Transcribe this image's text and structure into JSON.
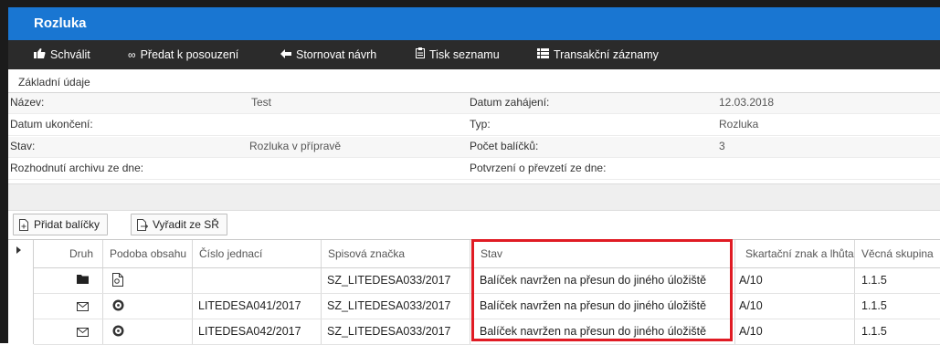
{
  "title": "Rozluka",
  "toolbar": {
    "approve": "Schválit",
    "review": "Předat k posouzení",
    "cancel": "Stornovat návrh",
    "print": "Tisk seznamu",
    "transactions": "Transakční záznamy"
  },
  "section": "Základní údaje",
  "form": {
    "nazev_label": "Název:",
    "nazev_value": "Test",
    "datum_zahajeni_label": "Datum zahájení:",
    "datum_zahajeni_value": "12.03.2018",
    "datum_ukonceni_label": "Datum ukončení:",
    "typ_label": "Typ:",
    "typ_value": "Rozluka",
    "stav_label": "Stav:",
    "stav_value": "Rozluka v přípravě",
    "pocet_label": "Počet balíčků:",
    "pocet_value": "3",
    "rozhodnuti_label": "Rozhodnutí archivu ze dne:",
    "potvrzeni_label": "Potvrzení o převzetí ze dne:"
  },
  "buttons": {
    "add": "Přidat balíčky",
    "remove": "Vyřadit ze SŘ"
  },
  "grid": {
    "headers": [
      "Druh",
      "Podoba obsahu",
      "Číslo jednací",
      "Spisová značka",
      "Stav",
      "Skartační znak a lhůta",
      "Věcná skupina"
    ],
    "rows": [
      {
        "druh_icon": "folder-icon",
        "podoba_icon": "document-icon",
        "cislo": "",
        "znacka": "SZ_LITEDESA033/2017",
        "stav": "Balíček navržen na přesun do jiného úložiště",
        "skartace": "A/10",
        "skupina": "1.1.5"
      },
      {
        "druh_icon": "envelope-icon",
        "podoba_icon": "disc-icon",
        "cislo": "LITEDESA041/2017",
        "znacka": "SZ_LITEDESA033/2017",
        "stav": "Balíček navržen na přesun do jiného úložiště",
        "skartace": "A/10",
        "skupina": "1.1.5"
      },
      {
        "druh_icon": "envelope-icon",
        "podoba_icon": "disc-icon",
        "cislo": "LITEDESA042/2017",
        "znacka": "SZ_LITEDESA033/2017",
        "stav": "Balíček navržen na přesun do jiného úložiště",
        "skartace": "A/10",
        "skupina": "1.1.5"
      }
    ]
  },
  "colors": {
    "title_bar": "#1976d2",
    "toolbar": "#2b2b2b",
    "highlight": "#e01b24"
  }
}
